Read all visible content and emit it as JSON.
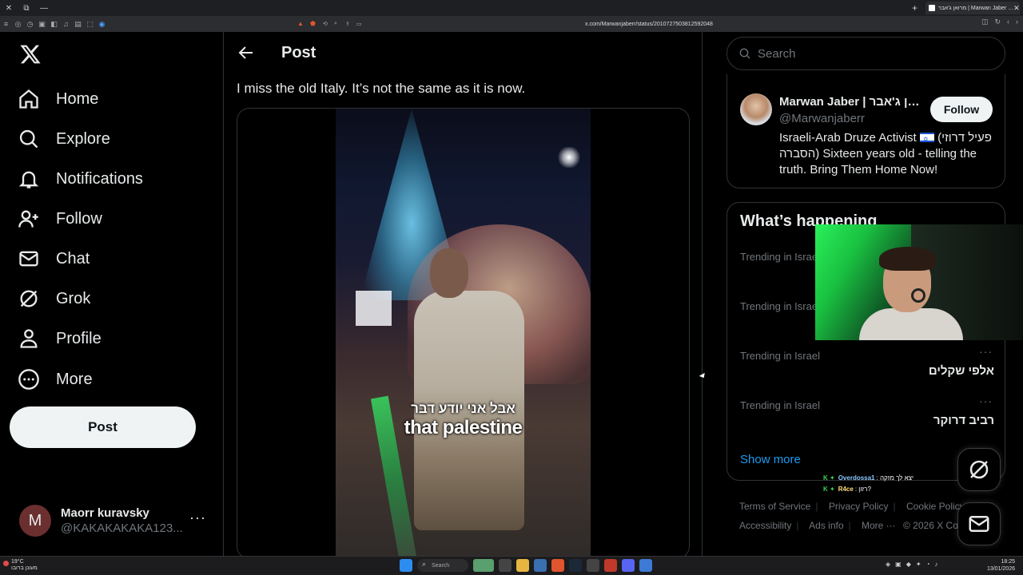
{
  "browser": {
    "tab_title": "מרואן ג'אבר | Marwan Jaber …",
    "url": "x.com/Marwanjaberr/status/2010727503812592048"
  },
  "sidebar": {
    "logo": "x-logo-icon",
    "items": [
      {
        "label": "Home",
        "icon": "home-icon"
      },
      {
        "label": "Explore",
        "icon": "search-icon"
      },
      {
        "label": "Notifications",
        "icon": "bell-icon"
      },
      {
        "label": "Follow",
        "icon": "follow-icon"
      },
      {
        "label": "Chat",
        "icon": "mail-icon"
      },
      {
        "label": "Grok",
        "icon": "grok-icon"
      },
      {
        "label": "Profile",
        "icon": "person-icon"
      },
      {
        "label": "More",
        "icon": "more-circle-icon"
      }
    ],
    "post_button": "Post",
    "account": {
      "initial": "M",
      "name": "Maorr kuravsky",
      "handle": "@KAKAKAKAKA123...",
      "more": "···"
    }
  },
  "main": {
    "title": "Post",
    "post_text": "I miss the old Italy. It’s not the same as it is now.",
    "video_subtitle_he": "אבל אני יודע דבר",
    "video_subtitle_en": "that palestine"
  },
  "right": {
    "search_placeholder": "Search",
    "profile": {
      "name": "Marwan Jaber | מרואן ג'אבר",
      "handle": "@Marwanjaberr",
      "follow_label": "Follow",
      "bio_prefix": "Israeli-Arab Druze Activist",
      "bio_rest": "(פעיל דרוזי הסברה) Sixteen years old - telling the truth. Bring Them Home Now!"
    },
    "trends_title": "What’s happening",
    "trends": [
      {
        "category": "Trending in Israel",
        "name": ""
      },
      {
        "category": "Trending in Israel",
        "name": ""
      },
      {
        "category": "Trending in Israel",
        "name": "אלפי שקלים"
      },
      {
        "category": "Trending in Israel",
        "name": "רביב דרוקר"
      }
    ],
    "show_more": "Show more",
    "footer": {
      "terms": "Terms of Service",
      "privacy": "Privacy Policy",
      "cookie": "Cookie Policy",
      "accessibility": "Accessibility",
      "ads": "Ads info",
      "more": "More ···",
      "copyright": "© 2026 X Corp."
    }
  },
  "chat": [
    {
      "user": "Overdossa1",
      "message": "יצא לך מזקה"
    },
    {
      "user": "R4ce",
      "message": "רזון?"
    }
  ],
  "taskbar": {
    "weather_temp": "19°C",
    "weather_desc": "מעונן ברובו",
    "search_label": "Search",
    "time": "18:25",
    "date": "13/01/2026"
  },
  "colors": {
    "accent": "#1d9bf0",
    "background": "#000000",
    "border": "#2f3336",
    "muted": "#71767b"
  }
}
